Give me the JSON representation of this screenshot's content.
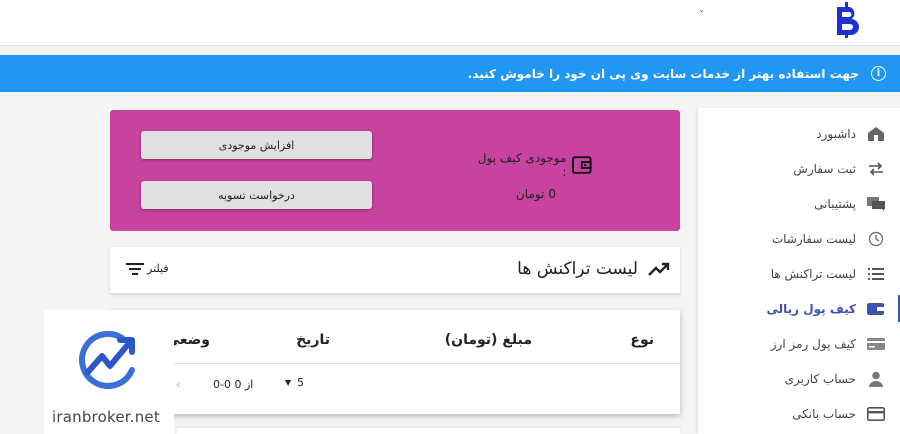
{
  "header": {
    "dropdown_caret": "ˇ",
    "logo_icon": "bitcoin-b-logo"
  },
  "banner": {
    "text": "جهت استفاده بهتر از خدمات سایت وی پی ان خود را خاموش کنید.",
    "icon": "info-icon",
    "color": "#2196f3"
  },
  "sidebar": {
    "items": [
      {
        "label": "داشبورد",
        "icon": "home-icon"
      },
      {
        "label": "ثبت سفارش",
        "icon": "swap-icon"
      },
      {
        "label": "پشتیبانی",
        "icon": "chat-icon"
      },
      {
        "label": "لیست سفارشات",
        "icon": "history-icon"
      },
      {
        "label": "لیست تراکنش ها",
        "icon": "list-icon"
      },
      {
        "label": "کیف پول ریالی",
        "icon": "wallet-icon",
        "active": true
      },
      {
        "label": "کیف پول رمز ارز",
        "icon": "card-icon"
      },
      {
        "label": "حساب کاربری",
        "icon": "user-icon"
      },
      {
        "label": "حساب بانکی",
        "icon": "bank-card-icon"
      }
    ],
    "active_color": "#3f51b5"
  },
  "wallet": {
    "title": "موجودی کیف پول :",
    "amount": "0",
    "currency": "تومان",
    "increase_label": "افزایش موجودی",
    "settle_label": "درخواست تسویه",
    "color": "#c8439f"
  },
  "transactions": {
    "title": "لیست تراکنش ها",
    "filter_label": "فیلتر",
    "columns": [
      "نوع",
      "مبلغ (تومان)",
      "تاریخ",
      "وضعی"
    ],
    "rows_per_page": "5",
    "range_text": "0-0 از 0",
    "prev_glyph": "‹"
  },
  "watermark": {
    "text": "iranbroker.net",
    "color": "#3b6fd8"
  }
}
